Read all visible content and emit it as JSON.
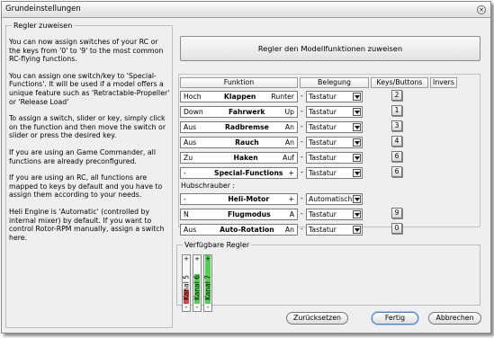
{
  "window": {
    "title": "Grundeinstellungen"
  },
  "left_panel": {
    "legend": "Regler zuweisen",
    "paragraphs": [
      "You can now assign switches of your RC or the keys from '0' to '9' to the most common RC-flying functions.",
      "You can assign one switch/key to 'Special-Functions'. It will be used if a model offers a unique feature such as 'Retractable-Propeller' or 'Release Load'",
      "To assign a switch, slider or key, simply click on the function and then move the switch or slider or press the desired key.",
      "If you are using an Game Commander, all functions are already preconfigured.",
      "If you are using an RC, all functions are mapped to keys by default and you have to assign them according to your needs.",
      "Heli Engine is 'Automatic' (controlled by internal mixer) by default. If you want to control Rotor-RPM manually, assign a switch here."
    ]
  },
  "assign_button": "Regler den Modellfunktionen zuweisen",
  "table": {
    "headers": {
      "funktion": "Funktion",
      "belegung": "Belegung",
      "keys": "Keys/Buttons",
      "invers": "Invers"
    },
    "rows": [
      {
        "low": "Hoch",
        "name": "Klappen",
        "high": "Runter",
        "belegung": "Tastatur",
        "key": "2"
      },
      {
        "low": "Down",
        "name": "Fahrwerk",
        "high": "Up",
        "belegung": "Tastatur",
        "key": "1"
      },
      {
        "low": "Aus",
        "name": "Radbremse",
        "high": "An",
        "belegung": "Tastatur",
        "key": "3"
      },
      {
        "low": "Aus",
        "name": "Rauch",
        "high": "An",
        "belegung": "Tastatur",
        "key": "4"
      },
      {
        "low": "Zu",
        "name": "Haken",
        "high": "Auf",
        "belegung": "Tastatur",
        "key": "6"
      },
      {
        "low": "-",
        "name": "Special-Functions",
        "high": "+",
        "belegung": "Tastatur",
        "key": "6"
      }
    ],
    "heli_label": "Hubschrauber :",
    "heli_rows": [
      {
        "low": "-",
        "name": "Heli-Motor",
        "high": "+",
        "belegung": "Automatisch",
        "key": ""
      },
      {
        "low": "N",
        "name": "Flugmodus",
        "high": "A",
        "belegung": "Tastatur",
        "key": "9"
      },
      {
        "low": "Aus",
        "name": "Auto-Rotation",
        "high": "An",
        "belegung": "Tastatur",
        "key": "0"
      }
    ],
    "dash": "-"
  },
  "available": {
    "legend": "Verfügbare Regler",
    "plus": "+",
    "minus": "-",
    "sliders": [
      {
        "label": "Kanal 5",
        "fill_from_bottom": 0.3,
        "color": "#d44a4a"
      },
      {
        "label": "Kanal 6",
        "fill_from_bottom": 0.62,
        "color": "#4fd04f"
      },
      {
        "label": "Kanal 7",
        "fill_from_bottom": 1.0,
        "color": "#4fd04f"
      }
    ]
  },
  "buttons": {
    "reset": "Zurücksetzen",
    "ok": "Fertig",
    "cancel": "Abbrechen"
  },
  "colors": {
    "accent": "#4a7fc0"
  }
}
